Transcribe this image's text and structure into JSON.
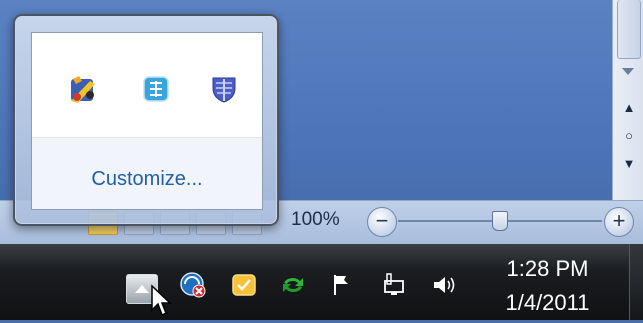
{
  "notification_overflow": {
    "icons": [
      {
        "name": "paint-tool-icon"
      },
      {
        "name": "grid-app-icon"
      },
      {
        "name": "shield-app-icon"
      }
    ],
    "customize_label": "Customize..."
  },
  "statusbar": {
    "zoom_value": "100%",
    "zoom_level_percent": 100,
    "zoom_minus_symbol": "−",
    "zoom_plus_symbol": "+"
  },
  "taskbar": {
    "tray_icons": [
      {
        "name": "network-security-icon"
      },
      {
        "name": "sticky-note-icon"
      },
      {
        "name": "sync-icon"
      },
      {
        "name": "flag-icon"
      },
      {
        "name": "network-icon"
      },
      {
        "name": "volume-icon"
      }
    ],
    "clock": {
      "time": "1:28 PM",
      "date": "1/4/2011"
    }
  },
  "colors": {
    "taskbar": "#141618",
    "link": "#1f5fa8",
    "accent_green": "#1f9a2d"
  }
}
